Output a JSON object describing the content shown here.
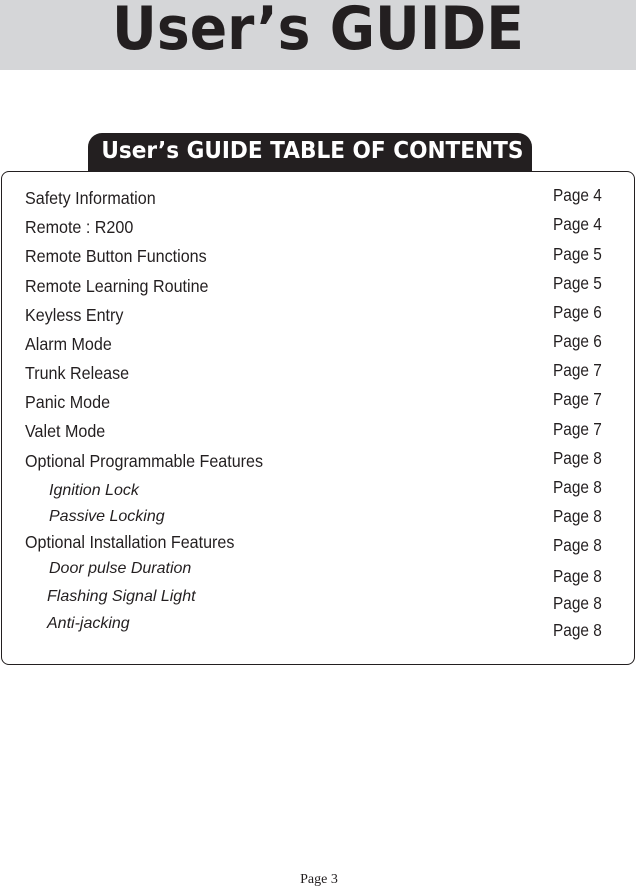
{
  "header": {
    "title": "User’s GUIDE"
  },
  "toc": {
    "heading": "User’s GUIDE TABLE OF CONTENTS",
    "entries": [
      {
        "label": "Safety Information",
        "page": "Page 4",
        "level": 0
      },
      {
        "label": "Remote : R200",
        "page": "Page 4",
        "level": 0
      },
      {
        "label": "Remote Button Functions",
        "page": "Page 5",
        "level": 0
      },
      {
        "label": "Remote Learning Routine",
        "page": "Page 5",
        "level": 0
      },
      {
        "label": "Keyless Entry",
        "page": "Page 6",
        "level": 0
      },
      {
        "label": "Alarm Mode",
        "page": "Page 6",
        "level": 0
      },
      {
        "label": "Trunk Release",
        "page": "Page 7",
        "level": 0
      },
      {
        "label": "Panic Mode",
        "page": "Page 7",
        "level": 0
      },
      {
        "label": "Valet Mode",
        "page": "Page 7",
        "level": 0
      },
      {
        "label": "Optional Programmable Features",
        "page": "Page 8",
        "level": 0
      },
      {
        "label": "Ignition Lock",
        "page": "Page 8",
        "level": 1
      },
      {
        "label": "Passive Locking",
        "page": "Page 8",
        "level": 1
      },
      {
        "label": "Optional Installation Features",
        "page": "Page 8",
        "level": 0
      },
      {
        "label": "Door pulse Duration",
        "page": "Page 8",
        "level": 1
      },
      {
        "label": "Flashing Signal Light",
        "page": "Page 8",
        "level": 1
      },
      {
        "label": "Anti-jacking",
        "page": "Page 8",
        "level": 1
      }
    ]
  },
  "footer": {
    "page_number": "Page 3"
  }
}
